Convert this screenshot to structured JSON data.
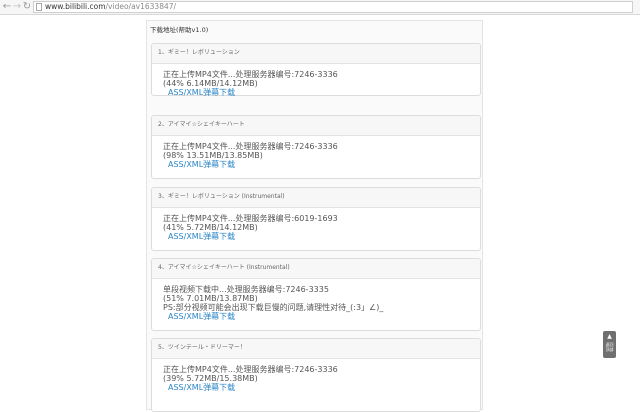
{
  "browser": {
    "nav": {
      "back": "←",
      "forward": "→",
      "reload": "↻"
    },
    "url_host": "www.bilibili.com",
    "url_path": "/video/av1633847/"
  },
  "panel": {
    "title": "下载地址(帮助v1.0)"
  },
  "videos": [
    {
      "title": "1、ギミー！レボリューション",
      "status": "正在上传MP4文件...处理服务器编号:7246-3336",
      "progress_text": "(44% 6.14MB/14.12MB)",
      "note": "",
      "link": "ASS/XML弹幕下载",
      "progress": 0.44
    },
    {
      "title": "2、アイマイ☆シェイキーハート",
      "status": "正在上传MP4文件...处理服务器编号:7246-3336",
      "progress_text": "(98% 13.51MB/13.85MB)",
      "note": "",
      "link": "ASS/XML弹幕下载",
      "progress": 0.98
    },
    {
      "title": "3、ギミー！レボリューション (Instrumental)",
      "status": "正在上传MP4文件...处理服务器编号:6019-1693",
      "progress_text": "(41% 5.72MB/14.12MB)",
      "note": "",
      "link": "ASS/XML弹幕下载",
      "progress": 0.41
    },
    {
      "title": "4、アイマイ☆シェイキーハート (Instrumental)",
      "status": "单段视频下载中...处理服务器编号:7246-3335",
      "progress_text": "(51% 7.01MB/13.87MB)",
      "note": "PS:部分视频可能会出现下载巨慢的问题,请理性对待_(:3」∠)_",
      "link": "ASS/XML弹幕下载",
      "progress": 0.51
    },
    {
      "title": "5、ツインテール・ドリーマー！",
      "status": "正在上传MP4文件...处理服务器编号:7246-3336",
      "progress_text": "(39% 5.72MB/15.38MB)",
      "note": "",
      "link": "ASS/XML弹幕下载",
      "progress": 0.39
    }
  ],
  "back_to_top": {
    "arrow": "▲",
    "label_line1": "返回",
    "label_line2": "顶部"
  }
}
